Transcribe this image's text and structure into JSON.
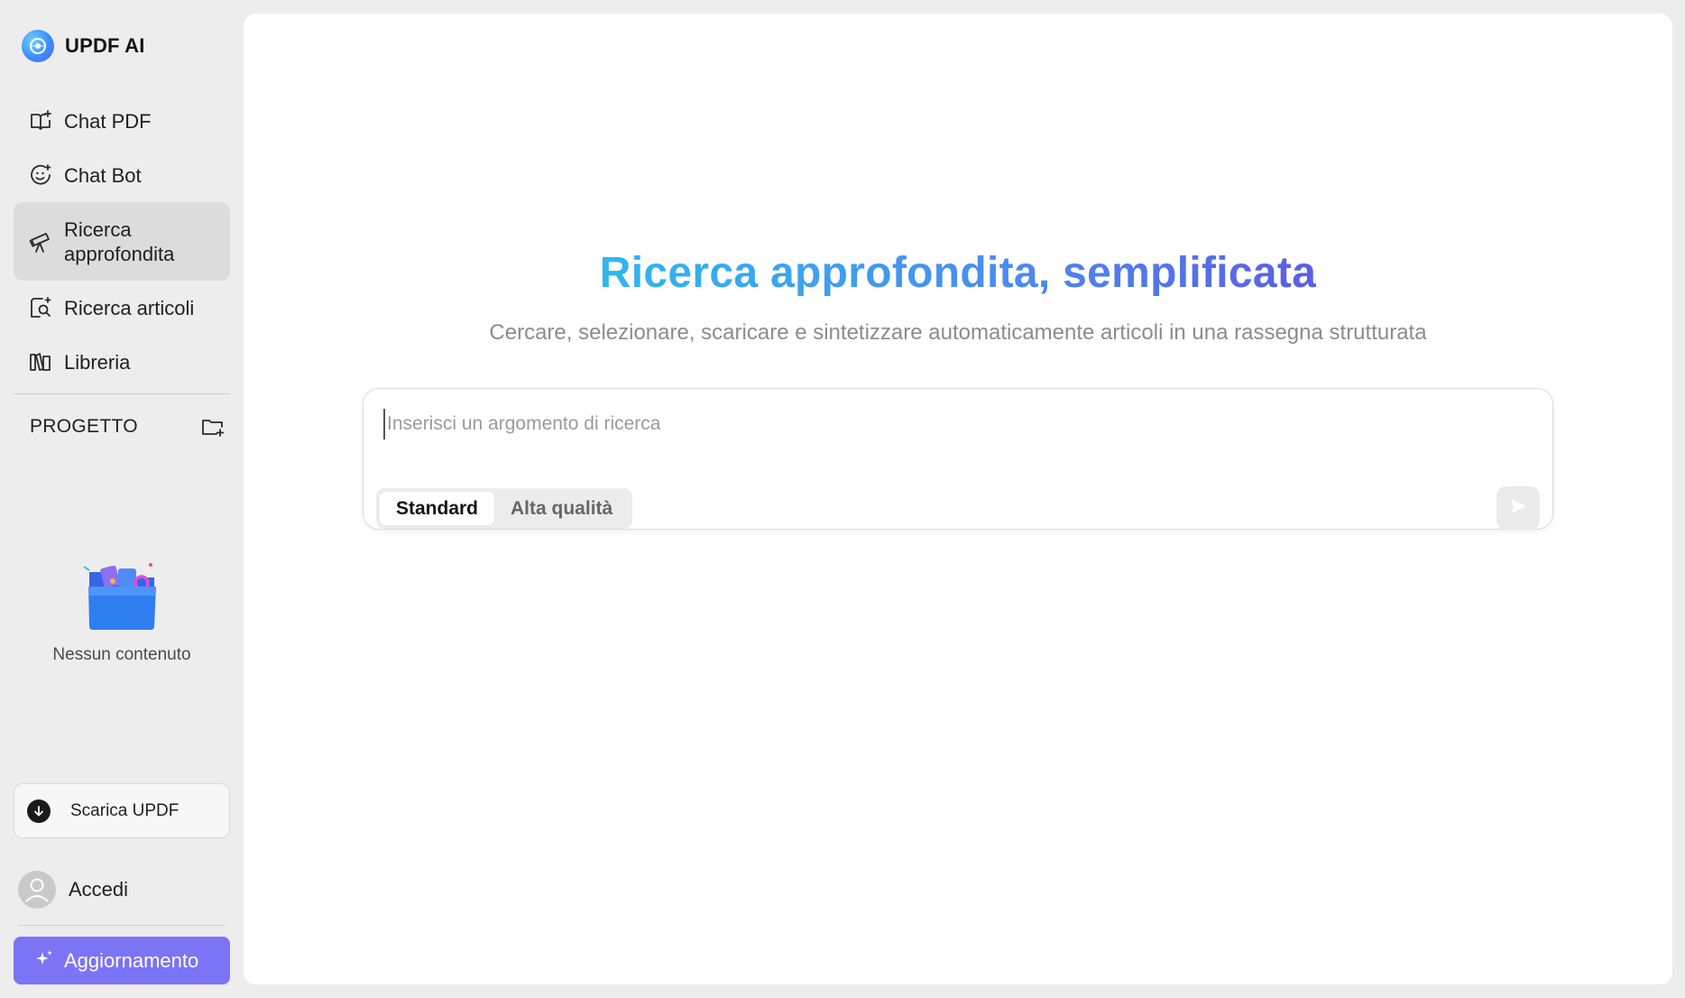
{
  "app": {
    "brand_name": "UPDF AI"
  },
  "sidebar": {
    "items": [
      {
        "label": "Chat PDF",
        "icon": "book-ai-icon"
      },
      {
        "label": "Chat Bot",
        "icon": "chatbot-face-icon"
      },
      {
        "label": "Ricerca\napprofondita",
        "icon": "telescope-icon",
        "active": true
      },
      {
        "label": "Ricerca articoli",
        "icon": "document-search-icon"
      },
      {
        "label": "Libreria",
        "icon": "library-books-icon"
      }
    ],
    "project_title": "PROGETTO",
    "empty_text": "Nessun contenuto",
    "download_label": "Scarica UPDF",
    "login_label": "Accedi",
    "upgrade_label": "Aggiornamento"
  },
  "main": {
    "headline": "Ricerca approfondita, semplificata",
    "subline": "Cercare, selezionare, scaricare e sintetizzare automaticamente articoli in una rassegna strutturata",
    "search": {
      "placeholder": "Inserisci un argomento di ricerca",
      "value": ""
    },
    "modes": [
      {
        "label": "Standard",
        "selected": true
      },
      {
        "label": "Alta qualità",
        "selected": false
      }
    ]
  },
  "colors": {
    "accent": "#7b74f5",
    "headline_gradient_start": "#2fb7ee",
    "headline_gradient_end": "#5b5ee8",
    "active_nav_bg": "#dcdcdc"
  }
}
